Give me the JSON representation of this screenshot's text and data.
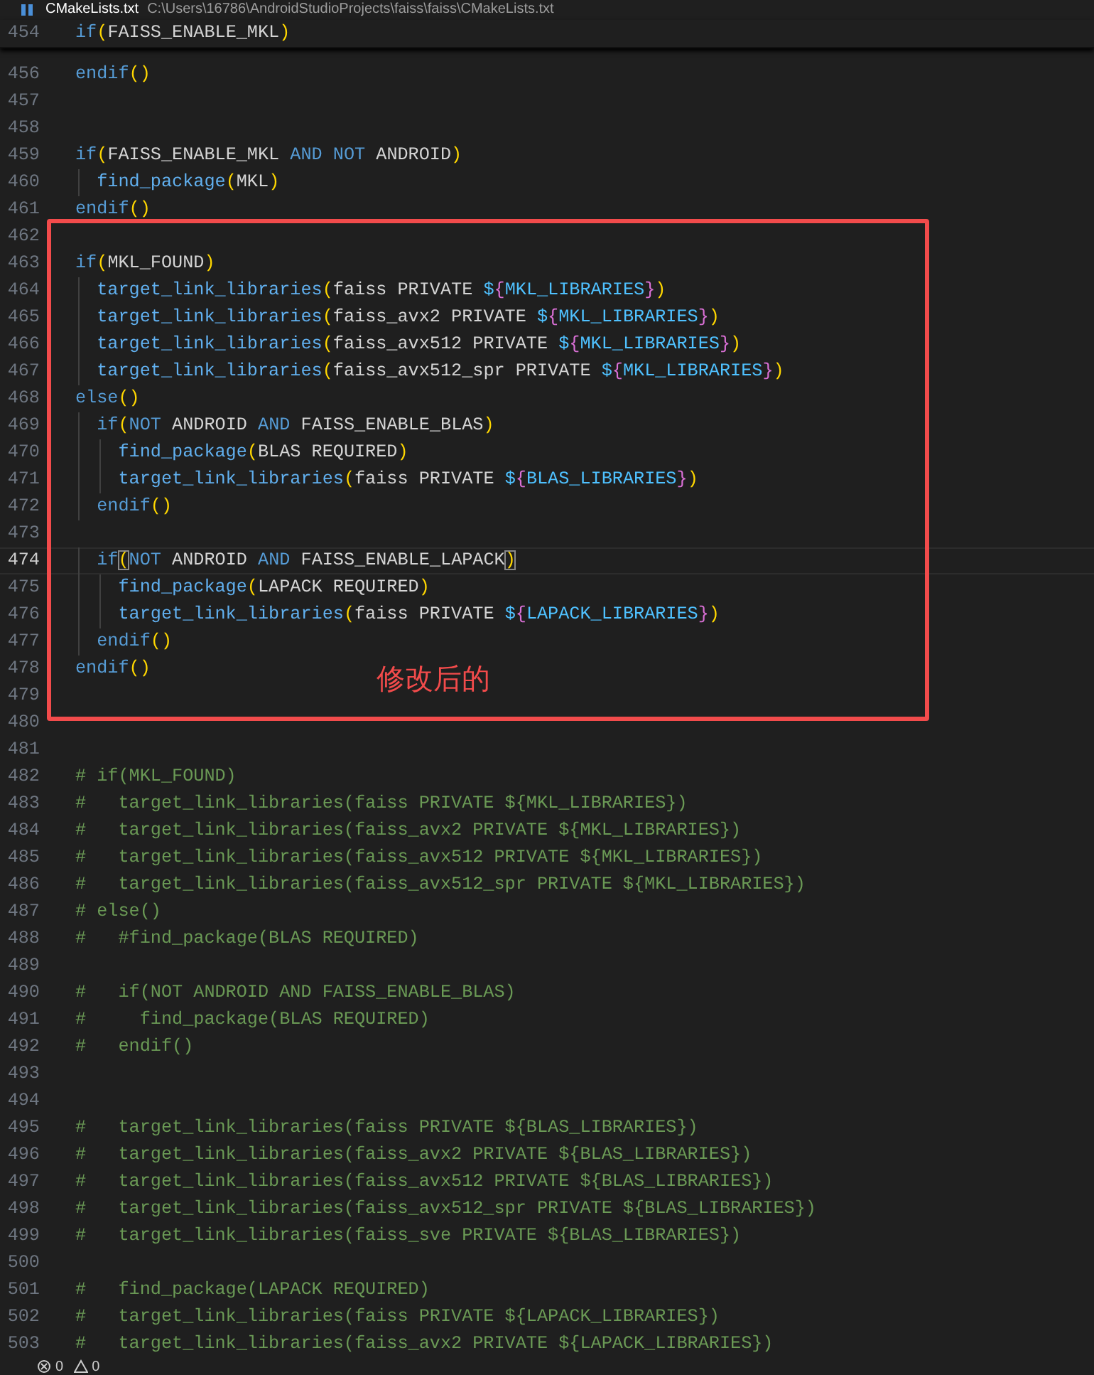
{
  "tab": {
    "name": "CMakeLists.txt",
    "path": "C:\\Users\\16786\\AndroidStudioProjects\\faiss\\faiss\\CMakeLists.txt"
  },
  "sticky_line": {
    "n": "454",
    "segs": [
      {
        "t": "if",
        "kind": "kw"
      },
      {
        "t": "(",
        "kind": "p"
      },
      {
        "t": "FAISS_ENABLE_MKL",
        "kind": "plain"
      },
      {
        "t": ")",
        "kind": "p"
      }
    ]
  },
  "lines": [
    {
      "n": "456",
      "current": false,
      "segs": [
        {
          "t": "endif",
          "kind": "kw"
        },
        {
          "t": "()",
          "kind": "p"
        }
      ]
    },
    {
      "n": "457",
      "current": false
    },
    {
      "n": "458",
      "current": false
    },
    {
      "n": "459",
      "current": false,
      "segs": [
        {
          "t": "if",
          "kind": "kw"
        },
        {
          "t": "(",
          "kind": "p"
        },
        {
          "t": "FAISS_ENABLE_MKL ",
          "kind": "plain"
        },
        {
          "t": "AND NOT",
          "kind": "kw"
        },
        {
          "t": " ANDROID",
          "kind": "plain"
        },
        {
          "t": ")",
          "kind": "p"
        }
      ]
    },
    {
      "n": "460",
      "current": false,
      "segs": [
        {
          "t": "  find_package",
          "kind": "fn"
        },
        {
          "t": "(",
          "kind": "p"
        },
        {
          "t": "MKL",
          "kind": "plain"
        },
        {
          "t": ")",
          "kind": "p"
        }
      ]
    },
    {
      "n": "461",
      "current": false,
      "segs": [
        {
          "t": "endif",
          "kind": "kw"
        },
        {
          "t": "()",
          "kind": "p"
        }
      ]
    },
    {
      "n": "462",
      "current": false
    },
    {
      "n": "463",
      "current": false,
      "segs": [
        {
          "t": "if",
          "kind": "kw"
        },
        {
          "t": "(",
          "kind": "p"
        },
        {
          "t": "MKL_FOUND",
          "kind": "plain"
        },
        {
          "t": ")",
          "kind": "p"
        }
      ]
    },
    {
      "n": "464",
      "current": false,
      "segs": [
        {
          "t": "  target_link_libraries",
          "kind": "fn"
        },
        {
          "t": "(",
          "kind": "p"
        },
        {
          "t": "faiss PRIVATE ",
          "kind": "plain"
        },
        {
          "t": "$",
          "kind": "var"
        },
        {
          "t": "{",
          "kind": "brace"
        },
        {
          "t": "MKL_LIBRARIES",
          "kind": "var"
        },
        {
          "t": "}",
          "kind": "brace"
        },
        {
          "t": ")",
          "kind": "p"
        }
      ]
    },
    {
      "n": "465",
      "current": false,
      "segs": [
        {
          "t": "  target_link_libraries",
          "kind": "fn"
        },
        {
          "t": "(",
          "kind": "p"
        },
        {
          "t": "faiss_avx2 PRIVATE ",
          "kind": "plain"
        },
        {
          "t": "$",
          "kind": "var"
        },
        {
          "t": "{",
          "kind": "brace"
        },
        {
          "t": "MKL_LIBRARIES",
          "kind": "var"
        },
        {
          "t": "}",
          "kind": "brace"
        },
        {
          "t": ")",
          "kind": "p"
        }
      ]
    },
    {
      "n": "466",
      "current": false,
      "segs": [
        {
          "t": "  target_link_libraries",
          "kind": "fn"
        },
        {
          "t": "(",
          "kind": "p"
        },
        {
          "t": "faiss_avx512 PRIVATE ",
          "kind": "plain"
        },
        {
          "t": "$",
          "kind": "var"
        },
        {
          "t": "{",
          "kind": "brace"
        },
        {
          "t": "MKL_LIBRARIES",
          "kind": "var"
        },
        {
          "t": "}",
          "kind": "brace"
        },
        {
          "t": ")",
          "kind": "p"
        }
      ]
    },
    {
      "n": "467",
      "current": false,
      "segs": [
        {
          "t": "  target_link_libraries",
          "kind": "fn"
        },
        {
          "t": "(",
          "kind": "p"
        },
        {
          "t": "faiss_avx512_spr PRIVATE ",
          "kind": "plain"
        },
        {
          "t": "$",
          "kind": "var"
        },
        {
          "t": "{",
          "kind": "brace"
        },
        {
          "t": "MKL_LIBRARIES",
          "kind": "var"
        },
        {
          "t": "}",
          "kind": "brace"
        },
        {
          "t": ")",
          "kind": "p"
        }
      ]
    },
    {
      "n": "468",
      "current": false,
      "segs": [
        {
          "t": "else",
          "kind": "kw"
        },
        {
          "t": "()",
          "kind": "p"
        }
      ]
    },
    {
      "n": "469",
      "current": false,
      "segs": [
        {
          "t": "  if",
          "kind": "kw"
        },
        {
          "t": "(",
          "kind": "p"
        },
        {
          "t": "NOT",
          "kind": "kw"
        },
        {
          "t": " ANDROID ",
          "kind": "plain"
        },
        {
          "t": "AND",
          "kind": "kw"
        },
        {
          "t": " FAISS_ENABLE_BLAS",
          "kind": "plain"
        },
        {
          "t": ")",
          "kind": "p"
        }
      ]
    },
    {
      "n": "470",
      "current": false,
      "segs": [
        {
          "t": "    find_package",
          "kind": "fn"
        },
        {
          "t": "(",
          "kind": "p"
        },
        {
          "t": "BLAS REQUIRED",
          "kind": "plain"
        },
        {
          "t": ")",
          "kind": "p"
        }
      ]
    },
    {
      "n": "471",
      "current": false,
      "segs": [
        {
          "t": "    target_link_libraries",
          "kind": "fn"
        },
        {
          "t": "(",
          "kind": "p"
        },
        {
          "t": "faiss PRIVATE ",
          "kind": "plain"
        },
        {
          "t": "$",
          "kind": "var"
        },
        {
          "t": "{",
          "kind": "brace"
        },
        {
          "t": "BLAS_LIBRARIES",
          "kind": "var"
        },
        {
          "t": "}",
          "kind": "brace"
        },
        {
          "t": ")",
          "kind": "p"
        }
      ]
    },
    {
      "n": "472",
      "current": false,
      "segs": [
        {
          "t": "  endif",
          "kind": "kw"
        },
        {
          "t": "()",
          "kind": "p"
        }
      ]
    },
    {
      "n": "473",
      "current": false
    },
    {
      "n": "474",
      "current": true,
      "segs": [
        {
          "t": "  if",
          "kind": "kw"
        },
        {
          "t": "(",
          "kind": "match"
        },
        {
          "t": "NOT",
          "kind": "kw"
        },
        {
          "t": " ANDROID ",
          "kind": "plain"
        },
        {
          "t": "AND",
          "kind": "kw"
        },
        {
          "t": " FAISS_ENABLE_LAPACK",
          "kind": "plain"
        },
        {
          "t": ")",
          "kind": "match"
        }
      ]
    },
    {
      "n": "475",
      "current": false,
      "segs": [
        {
          "t": "    find_package",
          "kind": "fn"
        },
        {
          "t": "(",
          "kind": "p"
        },
        {
          "t": "LAPACK REQUIRED",
          "kind": "plain"
        },
        {
          "t": ")",
          "kind": "p"
        }
      ]
    },
    {
      "n": "476",
      "current": false,
      "segs": [
        {
          "t": "    target_link_libraries",
          "kind": "fn"
        },
        {
          "t": "(",
          "kind": "p"
        },
        {
          "t": "faiss PRIVATE ",
          "kind": "plain"
        },
        {
          "t": "$",
          "kind": "var"
        },
        {
          "t": "{",
          "kind": "brace"
        },
        {
          "t": "LAPACK_LIBRARIES",
          "kind": "var"
        },
        {
          "t": "}",
          "kind": "brace"
        },
        {
          "t": ")",
          "kind": "p"
        }
      ]
    },
    {
      "n": "477",
      "current": false,
      "segs": [
        {
          "t": "  endif",
          "kind": "kw"
        },
        {
          "t": "()",
          "kind": "p"
        }
      ]
    },
    {
      "n": "478",
      "current": false,
      "segs": [
        {
          "t": "endif",
          "kind": "kw"
        },
        {
          "t": "()",
          "kind": "p"
        }
      ]
    },
    {
      "n": "479",
      "current": false
    },
    {
      "n": "480",
      "current": false
    },
    {
      "n": "481",
      "current": false
    },
    {
      "n": "482",
      "current": false,
      "segs": [
        {
          "t": "# if(MKL_FOUND)",
          "kind": "comment"
        }
      ]
    },
    {
      "n": "483",
      "current": false,
      "segs": [
        {
          "t": "#   target_link_libraries(faiss PRIVATE ${MKL_LIBRARIES})",
          "kind": "comment"
        }
      ]
    },
    {
      "n": "484",
      "current": false,
      "segs": [
        {
          "t": "#   target_link_libraries(faiss_avx2 PRIVATE ${MKL_LIBRARIES})",
          "kind": "comment"
        }
      ]
    },
    {
      "n": "485",
      "current": false,
      "segs": [
        {
          "t": "#   target_link_libraries(faiss_avx512 PRIVATE ${MKL_LIBRARIES})",
          "kind": "comment"
        }
      ]
    },
    {
      "n": "486",
      "current": false,
      "segs": [
        {
          "t": "#   target_link_libraries(faiss_avx512_spr PRIVATE ${MKL_LIBRARIES})",
          "kind": "comment"
        }
      ]
    },
    {
      "n": "487",
      "current": false,
      "segs": [
        {
          "t": "# else()",
          "kind": "comment"
        }
      ]
    },
    {
      "n": "488",
      "current": false,
      "segs": [
        {
          "t": "#   #find_package(BLAS REQUIRED)",
          "kind": "comment"
        }
      ]
    },
    {
      "n": "489",
      "current": false
    },
    {
      "n": "490",
      "current": false,
      "segs": [
        {
          "t": "#   if(NOT ANDROID AND FAISS_ENABLE_BLAS)",
          "kind": "comment"
        }
      ]
    },
    {
      "n": "491",
      "current": false,
      "segs": [
        {
          "t": "#     find_package(BLAS REQUIRED)",
          "kind": "comment"
        }
      ]
    },
    {
      "n": "492",
      "current": false,
      "segs": [
        {
          "t": "#   endif()",
          "kind": "comment"
        }
      ]
    },
    {
      "n": "493",
      "current": false
    },
    {
      "n": "494",
      "current": false
    },
    {
      "n": "495",
      "current": false,
      "segs": [
        {
          "t": "#   target_link_libraries(faiss PRIVATE ${BLAS_LIBRARIES})",
          "kind": "comment"
        }
      ]
    },
    {
      "n": "496",
      "current": false,
      "segs": [
        {
          "t": "#   target_link_libraries(faiss_avx2 PRIVATE ${BLAS_LIBRARIES})",
          "kind": "comment"
        }
      ]
    },
    {
      "n": "497",
      "current": false,
      "segs": [
        {
          "t": "#   target_link_libraries(faiss_avx512 PRIVATE ${BLAS_LIBRARIES})",
          "kind": "comment"
        }
      ]
    },
    {
      "n": "498",
      "current": false,
      "segs": [
        {
          "t": "#   target_link_libraries(faiss_avx512_spr PRIVATE ${BLAS_LIBRARIES})",
          "kind": "comment"
        }
      ]
    },
    {
      "n": "499",
      "current": false,
      "segs": [
        {
          "t": "#   target_link_libraries(faiss_sve PRIVATE ${BLAS_LIBRARIES})",
          "kind": "comment"
        }
      ]
    },
    {
      "n": "500",
      "current": false
    },
    {
      "n": "501",
      "current": false,
      "segs": [
        {
          "t": "#   find_package(LAPACK REQUIRED)",
          "kind": "comment"
        }
      ]
    },
    {
      "n": "502",
      "current": false,
      "segs": [
        {
          "t": "#   target_link_libraries(faiss PRIVATE ${LAPACK_LIBRARIES})",
          "kind": "comment"
        }
      ]
    },
    {
      "n": "503",
      "current": false,
      "segs": [
        {
          "t": "#   target_link_libraries(faiss_avx2 PRIVATE ${LAPACK_LIBRARIES})",
          "kind": "comment"
        }
      ]
    }
  ],
  "annotation": {
    "text": "修改后的"
  },
  "status_bar": {
    "errors": "0",
    "warnings": "0"
  }
}
